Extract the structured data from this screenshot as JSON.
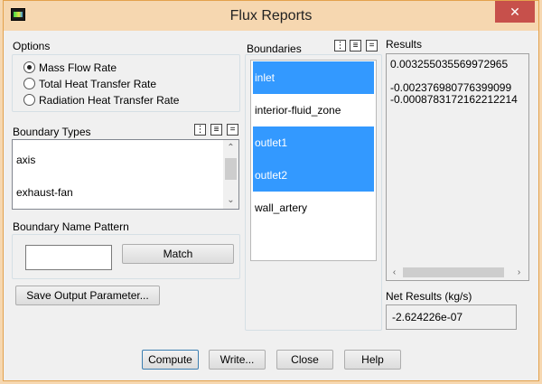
{
  "window": {
    "title": "Flux Reports",
    "close_label": "✕"
  },
  "options": {
    "label": "Options",
    "radios": [
      {
        "label": "Mass Flow Rate",
        "checked": true
      },
      {
        "label": "Total Heat Transfer Rate",
        "checked": false
      },
      {
        "label": "Radiation Heat Transfer Rate",
        "checked": false
      }
    ]
  },
  "boundary_types": {
    "label": "Boundary Types",
    "items": [
      "axis",
      "exhaust-fan"
    ]
  },
  "boundary_name_pattern": {
    "label": "Boundary Name Pattern",
    "value": "",
    "match_label": "Match"
  },
  "save_output_label": "Save Output Parameter...",
  "boundaries": {
    "label": "Boundaries",
    "items": [
      {
        "label": "inlet",
        "selected": true
      },
      {
        "label": "interior-fluid_zone",
        "selected": false
      },
      {
        "label": "outlet1",
        "selected": true
      },
      {
        "label": "outlet2",
        "selected": true
      },
      {
        "label": "wall_artery",
        "selected": false
      }
    ]
  },
  "results": {
    "label": "Results",
    "lines": [
      "0.003255035569972965",
      "",
      "-0.002376980776399099",
      "-0.0008783172162212214"
    ]
  },
  "net_results": {
    "label": "Net Results (kg/s)",
    "value": "-2.624226e-07"
  },
  "buttons": {
    "compute": "Compute",
    "write": "Write...",
    "close": "Close",
    "help": "Help"
  }
}
